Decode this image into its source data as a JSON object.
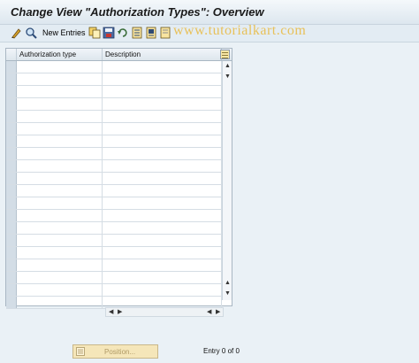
{
  "window": {
    "title": "Change View \"Authorization Types\": Overview"
  },
  "toolbar": {
    "new_entries_label": "New Entries",
    "watermark": "www.tutorialkart.com",
    "icons": [
      "edit-display-icon",
      "details-icon",
      "copy-icon",
      "save-icon",
      "undo-icon",
      "select-all-icon",
      "select-block-icon",
      "deselect-all-icon"
    ]
  },
  "table": {
    "columns": [
      "Authorization type",
      "Description"
    ],
    "rows": [],
    "empty_row_count": 20
  },
  "footer": {
    "position_label": "Position...",
    "entry_text": "Entry 0 of 0"
  },
  "colors": {
    "background": "#eaf1f6",
    "position_button": "#f5e6b9",
    "watermark": "#e8c15a"
  }
}
